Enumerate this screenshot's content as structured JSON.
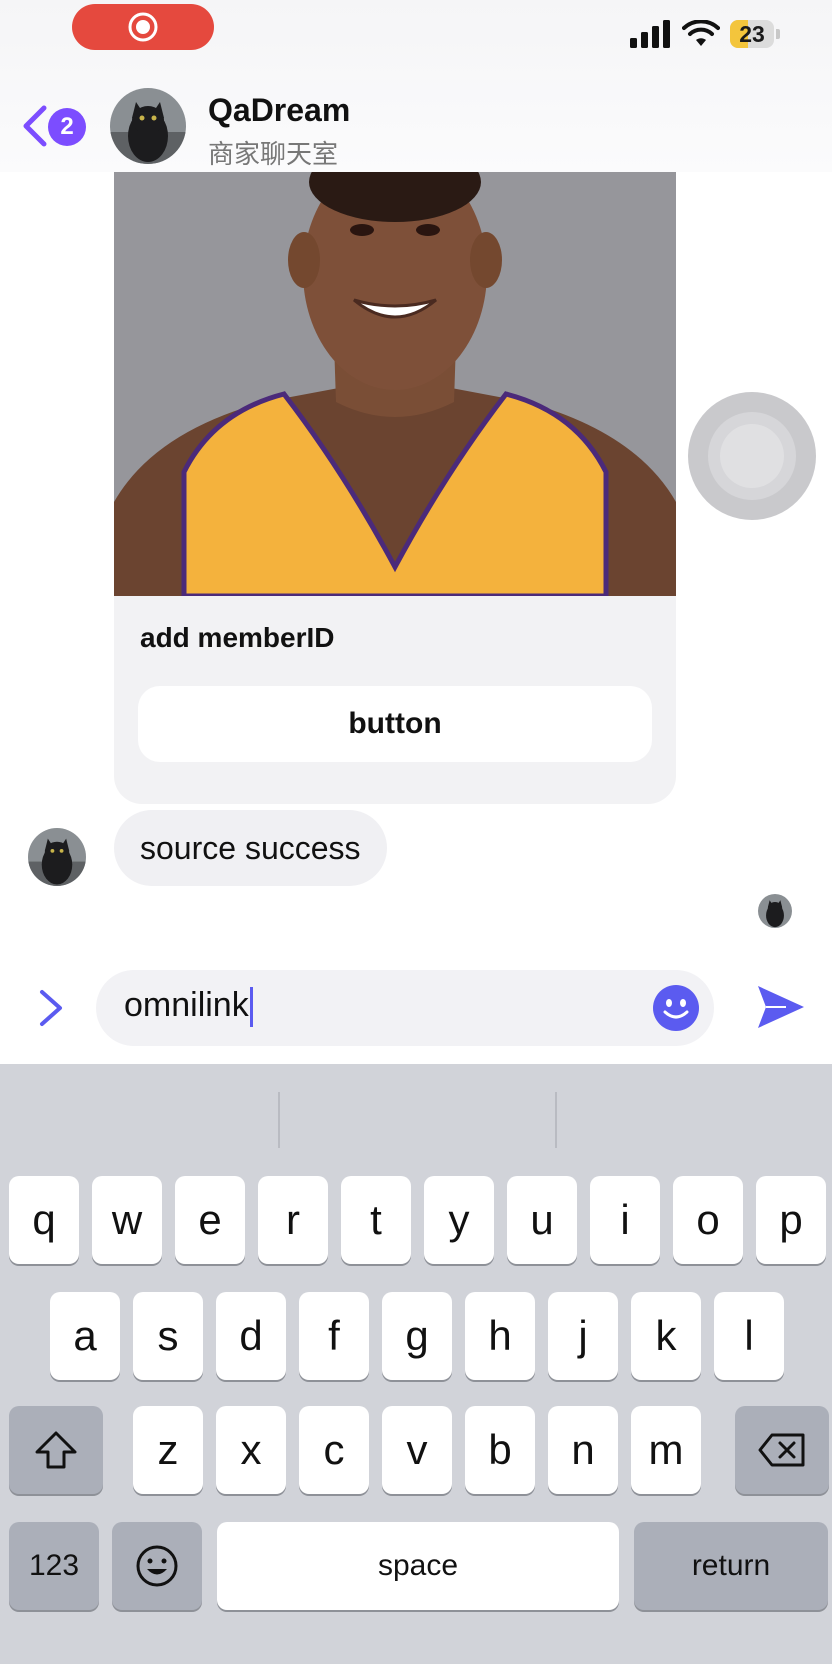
{
  "status_bar": {
    "battery": "23"
  },
  "header": {
    "back_badge": "2",
    "name": "QaDream",
    "subtitle": "商家聊天室"
  },
  "card": {
    "title": "add memberID",
    "button_label": "button"
  },
  "message": {
    "text": "source success"
  },
  "input": {
    "value": "omnilink"
  },
  "keyboard": {
    "row1": [
      "q",
      "w",
      "e",
      "r",
      "t",
      "y",
      "u",
      "i",
      "o",
      "p"
    ],
    "row2": [
      "a",
      "s",
      "d",
      "f",
      "g",
      "h",
      "j",
      "k",
      "l"
    ],
    "row3": [
      "z",
      "x",
      "c",
      "v",
      "b",
      "n",
      "m"
    ],
    "numbers_label": "123",
    "space_label": "space",
    "return_label": "return"
  },
  "colors": {
    "accent": "#5b5bf0",
    "badge": "#7c4dff",
    "record": "#e5493e"
  }
}
